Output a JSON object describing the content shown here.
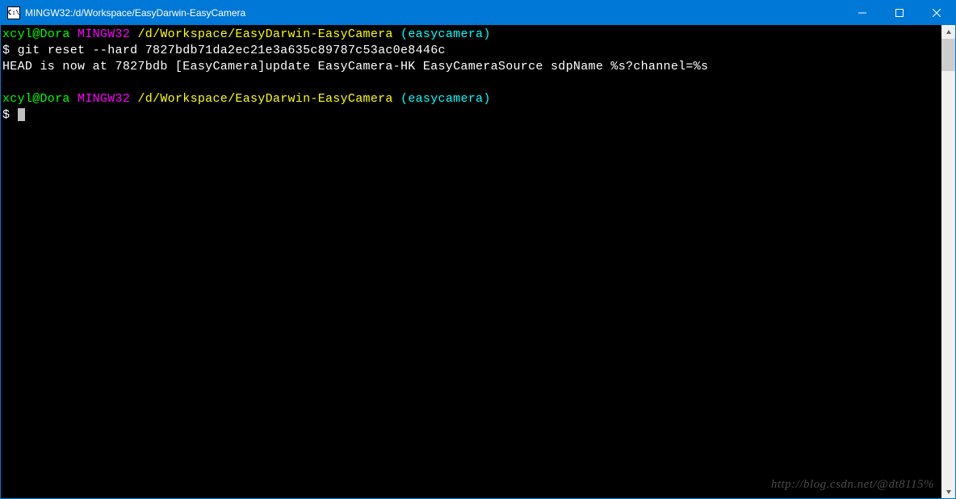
{
  "titlebar": {
    "icon_text": "C:\\",
    "title": "MINGW32:/d/Workspace/EasyDarwin-EasyCamera"
  },
  "terminal": {
    "prompt1": {
      "user": "xcyl@Dora",
      "host": "MINGW32",
      "path": "/d/Workspace/EasyDarwin-EasyCamera",
      "branch": "(easycamera)"
    },
    "line1_prefix": "$ ",
    "line1_cmd": "git reset --hard 7827bdb71da2ec21e3a635c89787c53ac0e8446c",
    "line2": "HEAD is now at 7827bdb [EasyCamera]update EasyCamera-HK EasyCameraSource sdpName %s?channel=%s",
    "prompt2": {
      "user": "xcyl@Dora",
      "host": "MINGW32",
      "path": "/d/Workspace/EasyDarwin-EasyCamera",
      "branch": "(easycamera)"
    },
    "line3_prefix": "$ "
  },
  "watermark": "http://blog.csdn.net/@dt8115%"
}
